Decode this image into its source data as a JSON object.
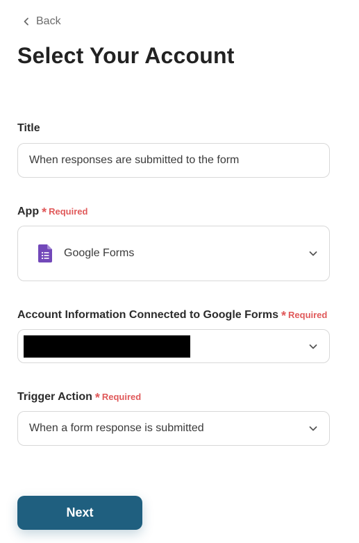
{
  "back": {
    "label": "Back"
  },
  "page_title": "Select Your Account",
  "required_label": "Required",
  "fields": {
    "title": {
      "label": "Title",
      "value": "When responses are submitted to the form"
    },
    "app": {
      "label": "App",
      "value": "Google Forms",
      "icon": "google-forms-icon",
      "icon_color": "#7248b9"
    },
    "account": {
      "label": "Account Information Connected to Google Forms"
    },
    "trigger": {
      "label": "Trigger Action",
      "value": "When a form response is submitted"
    }
  },
  "next_button": {
    "label": "Next"
  },
  "colors": {
    "primary": "#1f5f7f",
    "required": "#e0595a",
    "border": "#d8d8d8"
  }
}
